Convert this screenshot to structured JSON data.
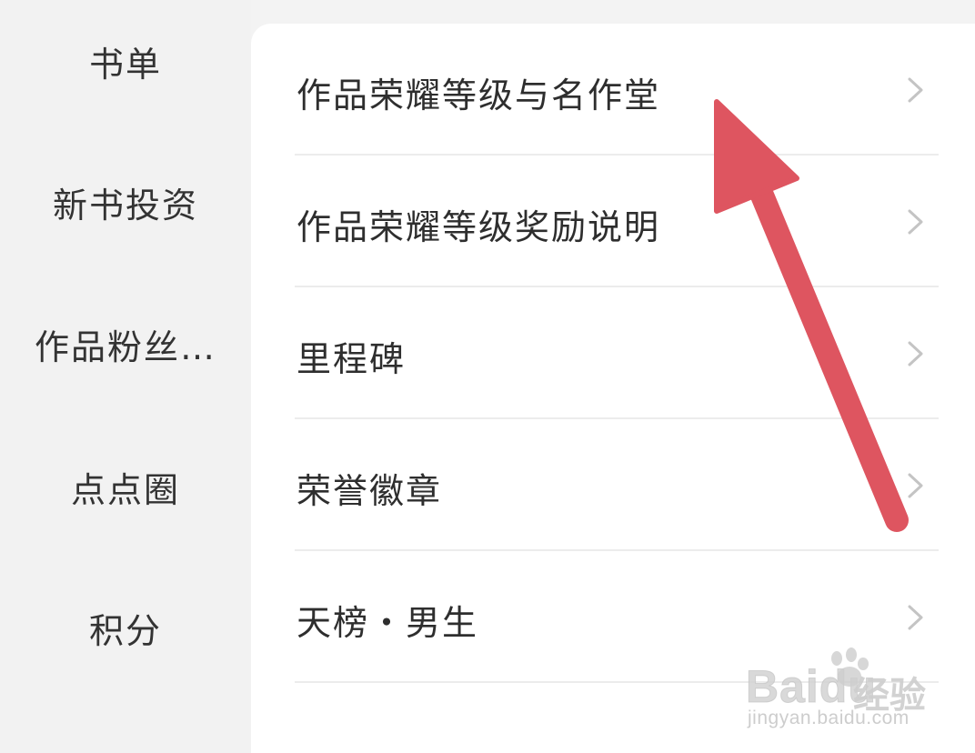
{
  "sidebar": {
    "items": [
      {
        "label": "书单"
      },
      {
        "label": "新书投资"
      },
      {
        "label": "作品粉丝…"
      },
      {
        "label": "点点圈"
      },
      {
        "label": "积分"
      }
    ]
  },
  "list": {
    "items": [
      {
        "label": "作品荣耀等级与名作堂"
      },
      {
        "label": "作品荣耀等级奖励说明"
      },
      {
        "label": "里程碑"
      },
      {
        "label": "荣誉徽章"
      },
      {
        "label": "天榜・男生"
      }
    ]
  },
  "annotation": {
    "arrow_color": "#de5560"
  },
  "watermark": {
    "brand": "Baidu",
    "name": "经验",
    "url": "jingyan.baidu.com"
  },
  "colors": {
    "sidebar_bg": "#f2f2f2",
    "panel_bg": "#ffffff",
    "text": "#2e2e2e",
    "divider": "#ececec",
    "chevron": "#c4c4c4"
  }
}
